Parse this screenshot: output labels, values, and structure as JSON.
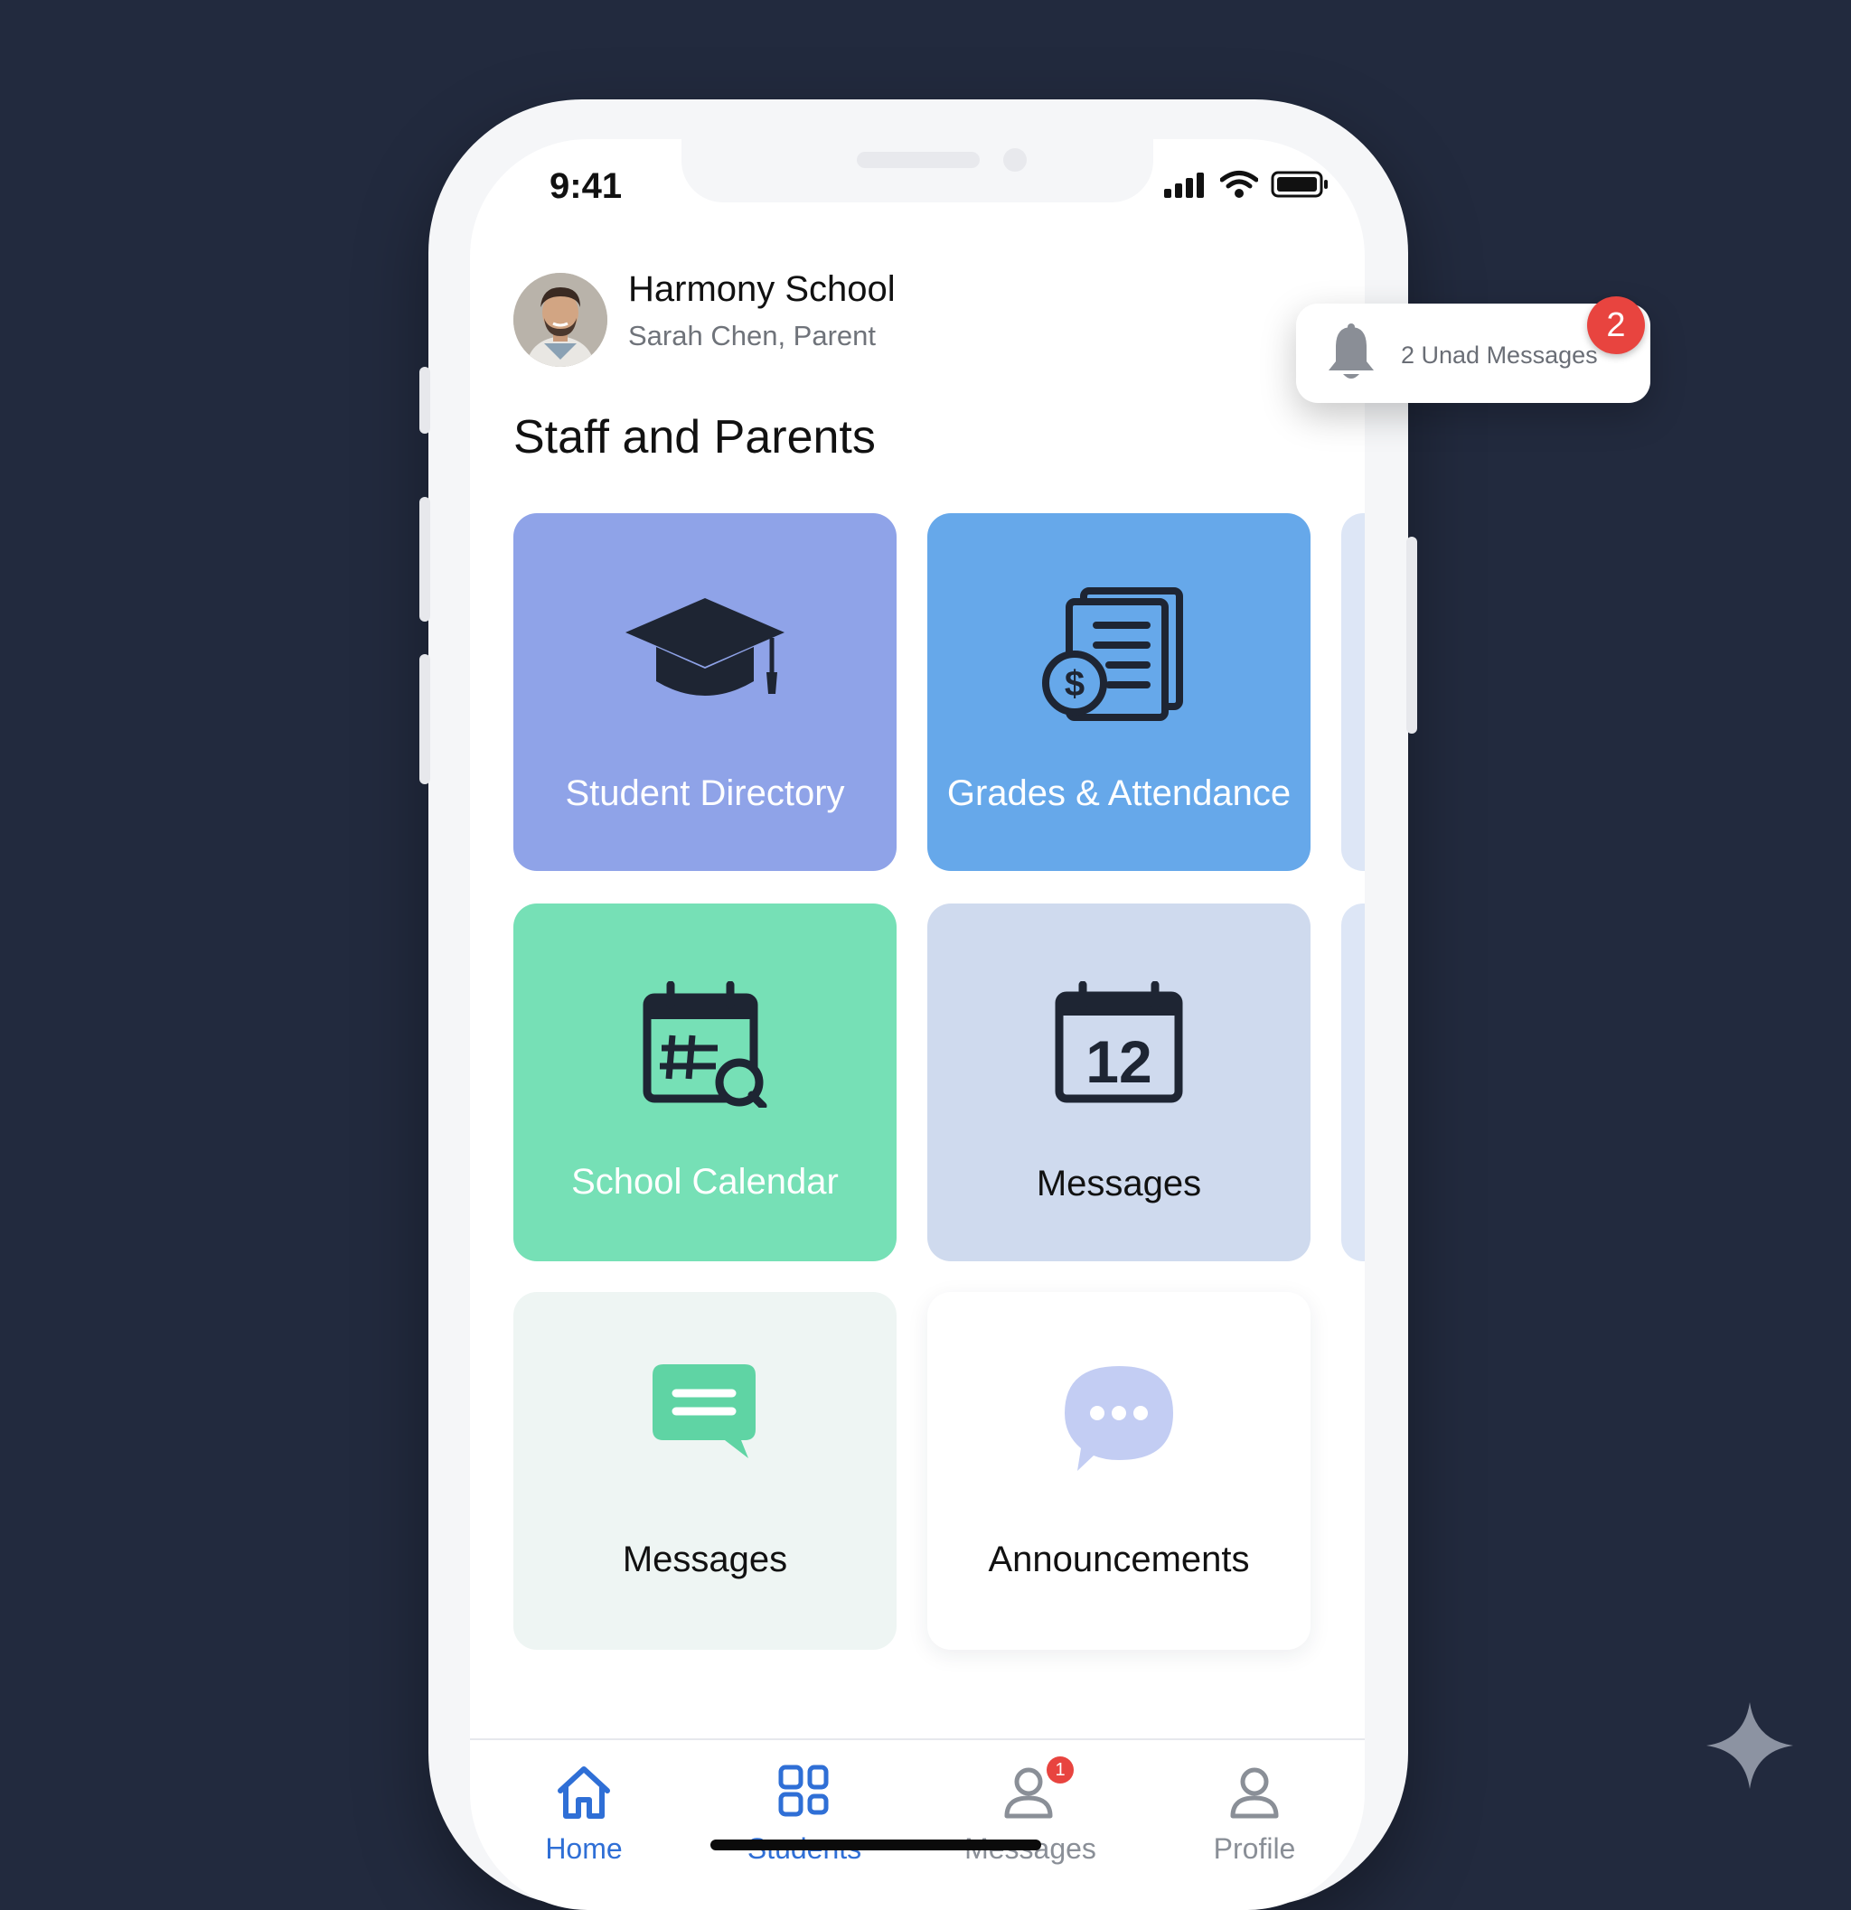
{
  "status_bar": {
    "time": "9:41"
  },
  "header": {
    "school_name": "Harmony School",
    "user_line": "Sarah Chen, Parent"
  },
  "section_title": "Staff and Parents",
  "tiles": [
    {
      "label": "Student Directory",
      "icon": "graduation-cap-icon",
      "color": "#8fa3e8"
    },
    {
      "label": "Grades & Attendance",
      "icon": "document-dollar-icon",
      "color": "#66a8ea"
    },
    {
      "label": "School Calendar",
      "icon": "calendar-search-icon",
      "color": "#76e0b6"
    },
    {
      "label": "Messages",
      "icon": "calendar-12-icon",
      "color": "#cfdaee"
    },
    {
      "label": "Messages",
      "icon": "chat-bubble-icon",
      "color": "#eef5f3"
    },
    {
      "label": "Announcements",
      "icon": "speech-bubble-dots-icon",
      "color": "#ffffff"
    }
  ],
  "notification": {
    "text": "2 Unad Messages",
    "badge_count": "2"
  },
  "tab_bar": [
    {
      "label": "Home",
      "icon": "home-icon",
      "active": true
    },
    {
      "label": "Students",
      "icon": "grid-icon",
      "active": true
    },
    {
      "label": "Messages",
      "icon": "person-icon",
      "badge": "1",
      "active": false
    },
    {
      "label": "Profile",
      "icon": "person-icon",
      "active": false
    }
  ],
  "colors": {
    "background": "#222a3e",
    "accent_blue": "#2f6fd6",
    "inactive_gray": "#8a8f97",
    "badge_red": "#e8443f"
  }
}
